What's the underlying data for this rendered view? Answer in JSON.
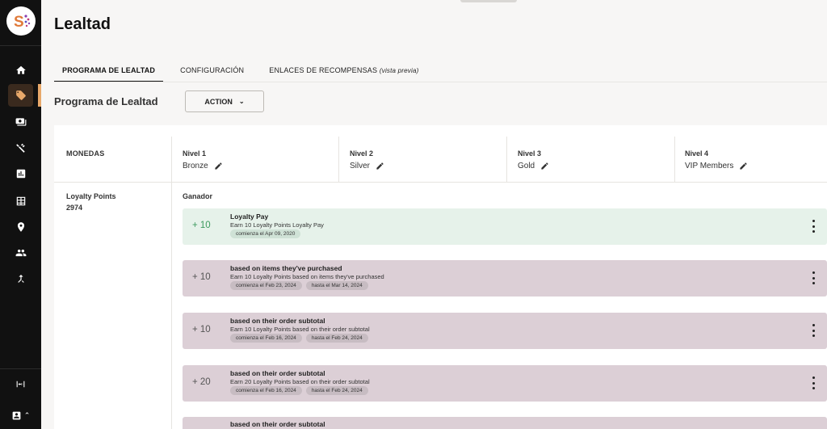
{
  "app": {
    "page_title": "Lealtad"
  },
  "sidebar": {
    "items": [
      {
        "name": "home",
        "icon": "home-icon"
      },
      {
        "name": "loyalty",
        "icon": "tag-icon",
        "active": true
      },
      {
        "name": "payments",
        "icon": "cash-icon"
      },
      {
        "name": "tools",
        "icon": "tools-icon"
      },
      {
        "name": "reports",
        "icon": "chart-icon"
      },
      {
        "name": "catalog",
        "icon": "table-icon"
      },
      {
        "name": "locations",
        "icon": "location-icon"
      },
      {
        "name": "customers",
        "icon": "people-icon"
      },
      {
        "name": "integrations",
        "icon": "merge-icon"
      }
    ],
    "bottom": [
      {
        "name": "expand",
        "icon": "expand-icon"
      },
      {
        "name": "account",
        "icon": "account-icon"
      }
    ],
    "colors": {
      "background": "#111111",
      "active_accent": "#e8a86a"
    }
  },
  "tabs": [
    {
      "label": "PROGRAMA DE LEALTAD",
      "active": true
    },
    {
      "label": "CONFIGURACIÓN"
    },
    {
      "label": "ENLACES DE RECOMPENSAS",
      "hint": "(vista previa)"
    }
  ],
  "section": {
    "title": "Programa de Lealtad",
    "action_label": "ACTION"
  },
  "table": {
    "currency_header": "MONEDAS",
    "levels": [
      {
        "label": "Nivel 1",
        "name": "Bronze"
      },
      {
        "label": "Nivel 2",
        "name": "Silver"
      },
      {
        "label": "Nivel 3",
        "name": "Gold"
      },
      {
        "label": "Nivel 4",
        "name": "VIP Members"
      }
    ],
    "currency": {
      "name": "Loyalty Points",
      "value": "2974"
    },
    "group_label": "Ganador",
    "rules": [
      {
        "points": "+ 10",
        "title": "Loyalty Pay",
        "desc": "Earn 10 Loyalty Points Loyalty Pay",
        "start": "comienza el Apr 09, 2020",
        "end": "",
        "color": "green"
      },
      {
        "points": "+ 10",
        "title": "based on items they've purchased",
        "desc": "Earn 10 Loyalty Points based on items they've purchased",
        "start": "comienza el Feb 23, 2024",
        "end": "hasta el Mar 14, 2024",
        "color": "mauve"
      },
      {
        "points": "+ 10",
        "title": "based on their order subtotal",
        "desc": "Earn 10 Loyalty Points based on their order subtotal",
        "start": "comienza el Feb 16, 2024",
        "end": "hasta el Feb 24, 2024",
        "color": "mauve"
      },
      {
        "points": "+ 20",
        "title": "based on their order subtotal",
        "desc": "Earn 20 Loyalty Points based on their order subtotal",
        "start": "comienza el Feb 16, 2024",
        "end": "hasta el Feb 24, 2024",
        "color": "mauve"
      },
      {
        "points": "",
        "title": "based on their order subtotal",
        "desc": "",
        "start": "",
        "end": "",
        "color": "mauve"
      }
    ]
  }
}
